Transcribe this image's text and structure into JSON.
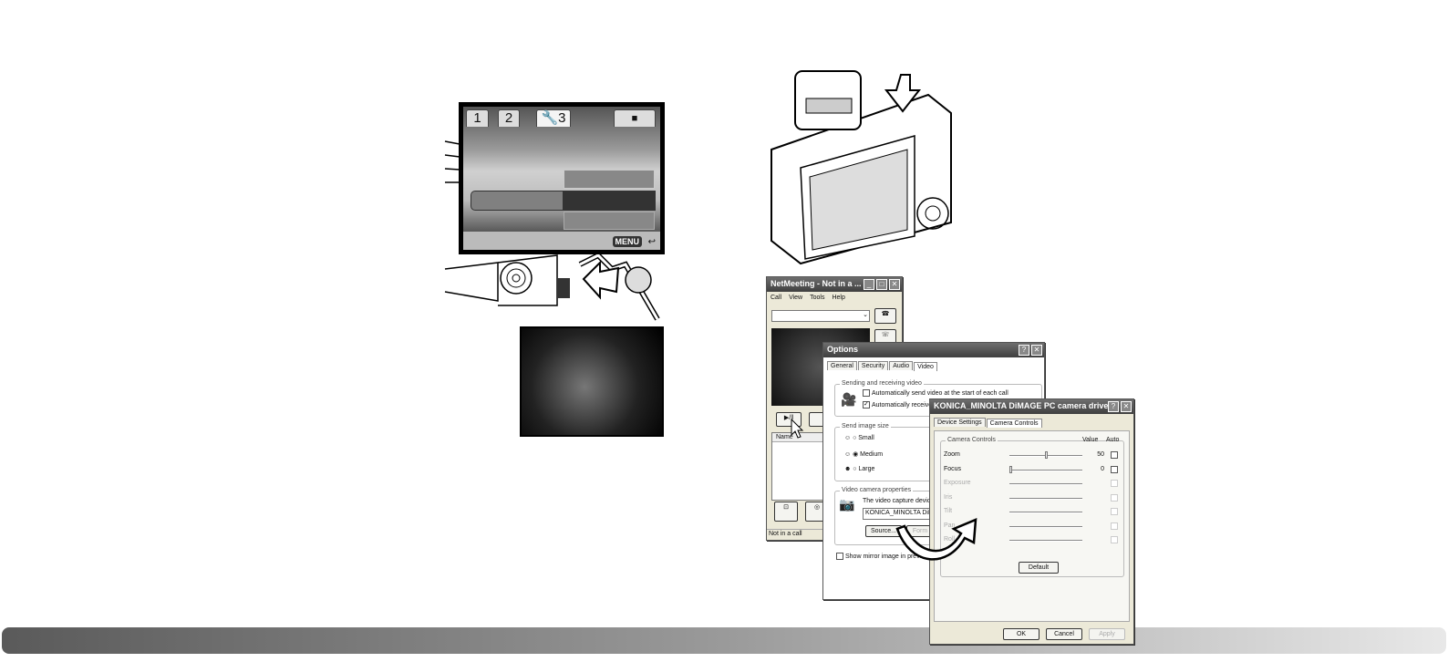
{
  "camera_lcd": {
    "tabs": [
      "1",
      "2",
      "3"
    ],
    "tab3_icon": "wrench-icon",
    "camera_tab_icon": "camera-icon",
    "footer_button": "MENU",
    "footer_icon": "return-icon"
  },
  "netmeeting": {
    "title": "NetMeeting - Not in a ...",
    "menu": [
      "Call",
      "View",
      "Tools",
      "Help"
    ],
    "list_header": "Name",
    "status": "Not in a call",
    "play_button": "▶/‖"
  },
  "options": {
    "title": "Options",
    "tabs": [
      "General",
      "Security",
      "Audio",
      "Video"
    ],
    "active_tab": "Video",
    "sending_group": "Sending and receiving video",
    "auto_send": "Automatically send video at the start of each call",
    "auto_send_checked": false,
    "auto_receive": "Automatically receive",
    "auto_receive_checked": true,
    "size_group": "Send image size",
    "sizes": [
      "Small",
      "Medium",
      "Large"
    ],
    "selected_size": "Medium",
    "camera_group": "Video camera properties",
    "capture_label": "The video capture device",
    "device_value": "KONICA_MINOLTA DiMA",
    "source_button": "Source...",
    "format_button": "Form",
    "mirror_label": "Show mirror image in preview vide"
  },
  "driver": {
    "title": "KONICA_MINOLTA DiMAGE PC camera driver",
    "tabs": [
      "Device Settings",
      "Camera Controls"
    ],
    "active_tab": "Camera Controls",
    "group": "Camera Controls",
    "value_header": "Value",
    "auto_header": "Auto",
    "controls": [
      {
        "label": "Zoom",
        "value": "50",
        "enabled": true,
        "slider_pct": 50
      },
      {
        "label": "Focus",
        "value": "0",
        "enabled": true,
        "slider_pct": 0
      },
      {
        "label": "Exposure",
        "value": "",
        "enabled": false
      },
      {
        "label": "Iris",
        "value": "",
        "enabled": false
      },
      {
        "label": "Tilt",
        "value": "",
        "enabled": false
      },
      {
        "label": "Pan",
        "value": "",
        "enabled": false
      },
      {
        "label": "Roll",
        "value": "",
        "enabled": false
      }
    ],
    "default_button": "Default",
    "ok_button": "OK",
    "cancel_button": "Cancel",
    "apply_button": "Apply"
  }
}
